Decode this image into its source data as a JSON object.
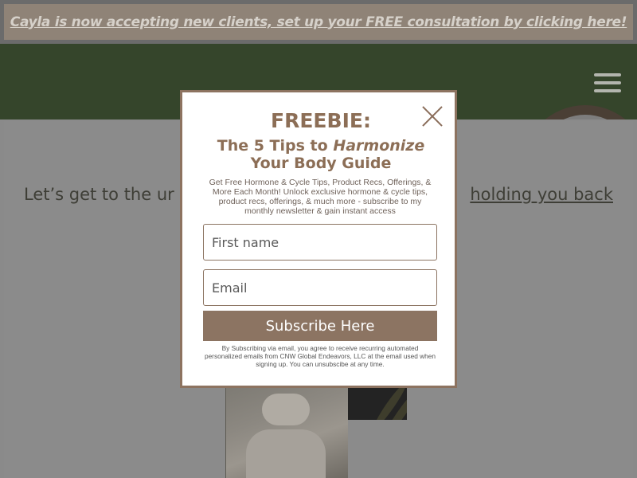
{
  "announcement": {
    "text": "Cayla is now accepting new clients, set up your FREE consultation by clicking here!"
  },
  "header": {
    "menu_icon": "hamburger-menu-icon"
  },
  "hero": {
    "text_left": "Let’s get to the ur",
    "text_right": "holding you back"
  },
  "modal": {
    "title": "FREEBIE:",
    "subtitle_prefix": "The 5 Tips to ",
    "subtitle_emphasis": "Harmonize",
    "subtitle_line2": "Your Body Guide",
    "description": "Get Free Hormone & Cycle Tips, Product Recs, Offerings, & More Each Month! Unlock exclusive hormone & cycle tips, product recs, offerings, & much more - subscribe to my monthly newsletter & gain instant access",
    "first_name_placeholder": "First name",
    "email_placeholder": "Email",
    "submit_label": "Subscribe Here",
    "legal": "By Subscribing via email, you agree to receive recurring automated personalized emails from CNW Global Endeavors, LLC at the email used when signing up. You can unsubscibe at any time.",
    "close_icon": "close-icon"
  },
  "colors": {
    "accent": "#8c7462",
    "header_bg": "#35452b",
    "announcement_bg": "#8f8377"
  }
}
